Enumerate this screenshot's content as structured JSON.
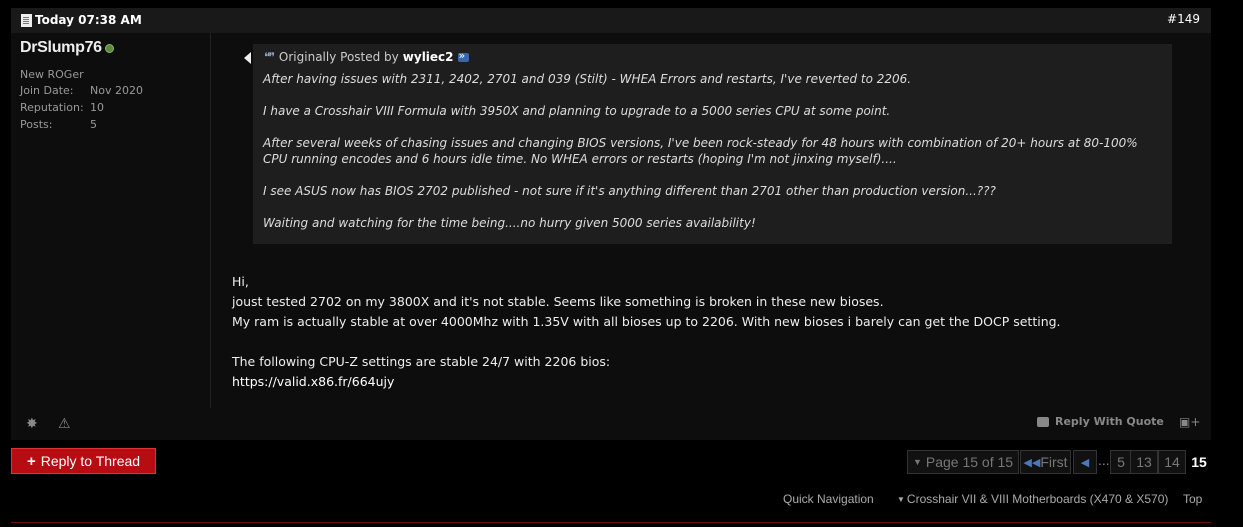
{
  "post": {
    "date": "Today 07:38 AM",
    "number": "#149"
  },
  "user": {
    "name": "DrSlump76",
    "title": "New ROGer",
    "stats": [
      {
        "label": "Join Date:",
        "value": "Nov 2020"
      },
      {
        "label": "Reputation:",
        "value": "10"
      },
      {
        "label": "Posts:",
        "value": "5"
      }
    ]
  },
  "quote": {
    "prefix": "Originally Posted by",
    "author": "wyliec2",
    "paragraphs": [
      "After having issues with 2311, 2402, 2701 and 039 (Stilt) - WHEA Errors and restarts, I've reverted to 2206.",
      "I have a Crosshair VIII Formula with 3950X and planning to upgrade to a 5000 series CPU at some point.",
      "After several weeks of chasing issues and changing BIOS versions, I've been rock-steady for 48 hours with combination of 20+ hours at 80-100% CPU running encodes and 6 hours idle time. No WHEA errors or restarts (hoping I'm not jinxing myself)....",
      "I see ASUS now has BIOS 2702 published - not sure if it's anything different than 2701 other than production version...???",
      "Waiting and watching for the time being....no hurry given 5000 series availability!"
    ]
  },
  "message": {
    "lines": [
      "Hi,",
      "joust tested 2702 on my 3800X and it's not stable. Seems like something is broken in these new bioses.",
      "My ram is actually stable at over 4000Mhz with 1.35V with all bioses up to 2206. With new bioses i barely can get the DOCP setting."
    ],
    "line4": "The following CPU-Z settings are stable 24/7 with 2206 bios:",
    "link": "https://valid.x86.fr/664ujy"
  },
  "footer": {
    "reply_with_quote": "Reply With Quote"
  },
  "reply_button": "Reply to Thread",
  "pagination": {
    "page_info": "Page 15 of 15",
    "first": "First",
    "ellipsis": "...",
    "pages": [
      "5",
      "13",
      "14",
      "15"
    ],
    "current": "15"
  },
  "bottom_nav": {
    "quick_navigation": "Quick Navigation",
    "forum": "Crosshair VII & VIII Motherboards (X470 & X570)",
    "top": "Top"
  },
  "colors": {
    "accent_red": "#b60c12",
    "online": "#5b8a3c"
  }
}
